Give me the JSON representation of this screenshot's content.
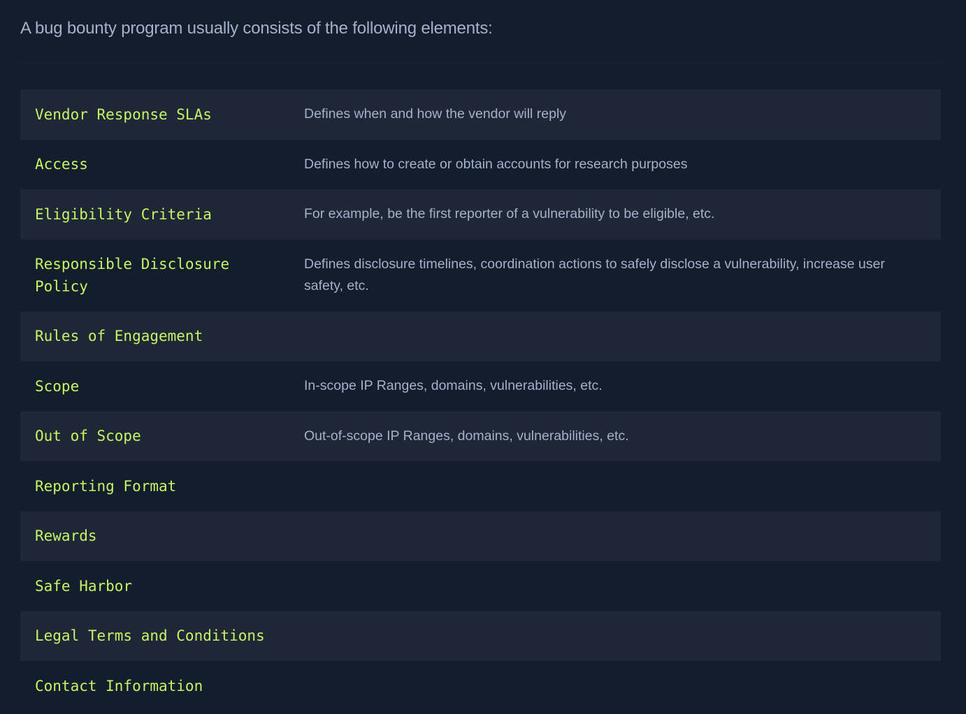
{
  "intro": "A bug bounty program usually consists of the following elements:",
  "colors": {
    "background": "#141d2b",
    "row_alt": "#1f2736",
    "term": "#c5f467",
    "text": "#a4b1cd"
  },
  "rows": [
    {
      "term": "Vendor Response SLAs",
      "description": "Defines when and how the vendor will reply"
    },
    {
      "term": "Access",
      "description": "Defines how to create or obtain accounts for research purposes"
    },
    {
      "term": "Eligibility Criteria",
      "description": "For example, be the first reporter of a vulnerability to be eligible, etc."
    },
    {
      "term": "Responsible Disclosure Policy",
      "description": "Defines disclosure timelines, coordination actions to safely disclose a vulnerability, increase user safety, etc."
    },
    {
      "term": "Rules of Engagement",
      "description": ""
    },
    {
      "term": "Scope",
      "description": "In-scope IP Ranges, domains, vulnerabilities, etc."
    },
    {
      "term": "Out of Scope",
      "description": "Out-of-scope IP Ranges, domains, vulnerabilities, etc."
    },
    {
      "term": "Reporting Format",
      "description": ""
    },
    {
      "term": "Rewards",
      "description": ""
    },
    {
      "term": "Safe Harbor",
      "description": ""
    },
    {
      "term": "Legal Terms and Conditions",
      "description": ""
    },
    {
      "term": "Contact Information",
      "description": ""
    }
  ]
}
